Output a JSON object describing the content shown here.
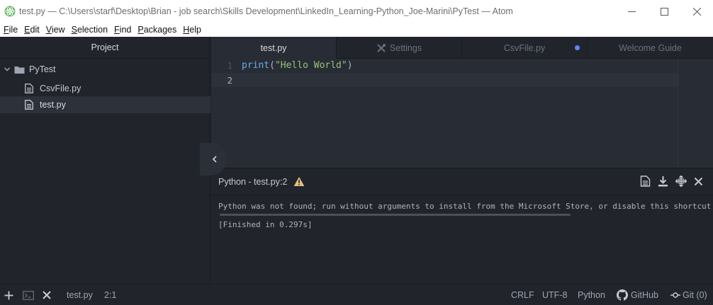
{
  "window": {
    "title": "test.py — C:\\Users\\starf\\Desktop\\Brian - job search\\Skills Development\\LinkedIn_Learning-Python_Joe-Marini\\PyTest — Atom",
    "controls": [
      "minimize",
      "maximize",
      "close"
    ]
  },
  "menu": {
    "items": [
      {
        "u": "F",
        "rest": "ile"
      },
      {
        "u": "E",
        "rest": "dit"
      },
      {
        "u": "V",
        "rest": "iew"
      },
      {
        "u": "S",
        "rest": "election"
      },
      {
        "u": "F",
        "rest": "ind"
      },
      {
        "u": "P",
        "rest": "ackages"
      },
      {
        "u": "H",
        "rest": "elp"
      }
    ]
  },
  "tree": {
    "header": "Project",
    "root": "PyTest",
    "files": [
      "CsvFile.py",
      "test.py"
    ],
    "selected_index": 1
  },
  "tabs": [
    {
      "label": "test.py",
      "active": true
    },
    {
      "label": "Settings",
      "active": false
    },
    {
      "label": "CsvFile.py",
      "active": false,
      "modified": true
    },
    {
      "label": "Welcome Guide",
      "active": false
    }
  ],
  "editor": {
    "line_numbers": [
      "1",
      "2"
    ],
    "code": {
      "fn": "print",
      "open": "(",
      "str": "\"Hello World\"",
      "close": ")"
    }
  },
  "panel": {
    "title": "Python - test.py:2",
    "lines": [
      "Python was not found; run without arguments to install from the Microsoft Store, or disable this shortcut from S",
      "[Finished in 0.297s]"
    ]
  },
  "status": {
    "file": "test.py",
    "cursor": "2:1",
    "line_ending": "CRLF",
    "encoding": "UTF-8",
    "grammar": "Python",
    "github": "GitHub",
    "git": "Git (0)"
  },
  "colors": {
    "accent_blue": "#568af2",
    "warning": "#e5c07b",
    "string": "#98c379",
    "function": "#61afef"
  }
}
